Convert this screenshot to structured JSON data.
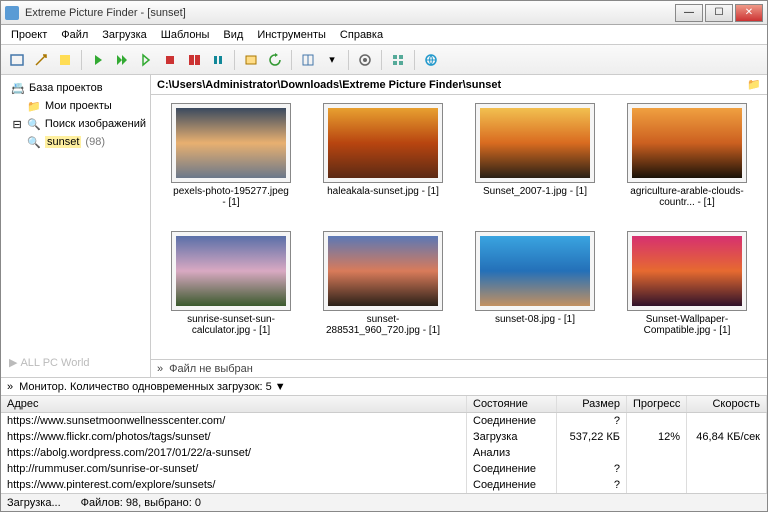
{
  "window": {
    "title": "Extreme Picture Finder - [sunset]"
  },
  "menu": [
    "Проект",
    "Файл",
    "Загрузка",
    "Шаблоны",
    "Вид",
    "Инструменты",
    "Справка"
  ],
  "sidebar": {
    "projects": "База проектов",
    "my_projects": "Мои проекты",
    "search": "Поиск изображений",
    "query": "sunset",
    "query_count": "(98)"
  },
  "watermark": "ALL PC World",
  "path": "C:\\Users\\Administrator\\Downloads\\Extreme Picture Finder\\sunset",
  "thumbs": [
    {
      "name": "pexels-photo-195277.jpeg - [1]",
      "g": "linear-gradient(#3a4a5f,#e8b070,#6b788a)"
    },
    {
      "name": "haleakala-sunset.jpg - [1]",
      "g": "linear-gradient(#e8a030,#b84510,#5b2a14)"
    },
    {
      "name": "Sunset_2007-1.jpg - [1]",
      "g": "linear-gradient(#f2c050,#d96b20,#2a2015)"
    },
    {
      "name": "agriculture-arable-clouds-countr... - [1]",
      "g": "linear-gradient(#f0a040,#cc6020,#1a1208)"
    },
    {
      "name": "sunrise-sunset-sun-calculator.jpg - [1]",
      "g": "linear-gradient(#5a6fa8,#d9a9c2,#3b5a2d)"
    },
    {
      "name": "sunset-288531_960_720.jpg - [1]",
      "g": "linear-gradient(#5b78b5,#d97b5a,#2b2018)"
    },
    {
      "name": "sunset-08.jpg - [1]",
      "g": "linear-gradient(#3aa4e0,#2470b8,#c29060)"
    },
    {
      "name": "Sunset-Wallpaper-Compatible.jpg - [1]",
      "g": "linear-gradient(#d63070,#e66a30,#30122a)"
    }
  ],
  "filesel": "Файл не выбран",
  "monitor": "Монитор. Количество одновременных загрузок: 5   ▼",
  "dl": {
    "headers": {
      "addr": "Адрес",
      "state": "Состояние",
      "size": "Размер",
      "prog": "Прогресс",
      "speed": "Скорость"
    },
    "rows": [
      {
        "addr": "https://www.sunsetmoonwellnesscenter.com/",
        "state": "Соединение",
        "size": "?",
        "prog": "",
        "speed": ""
      },
      {
        "addr": "https://www.flickr.com/photos/tags/sunset/",
        "state": "Загрузка",
        "size": "537,22 КБ",
        "prog": "12%",
        "speed": "46,84 КБ/сек"
      },
      {
        "addr": "https://abolg.wordpress.com/2017/01/22/a-sunset/",
        "state": "Анализ",
        "size": "",
        "prog": "",
        "speed": ""
      },
      {
        "addr": "http://rummuser.com/sunrise-or-sunset/",
        "state": "Соединение",
        "size": "?",
        "prog": "",
        "speed": ""
      },
      {
        "addr": "https://www.pinterest.com/explore/sunsets/",
        "state": "Соединение",
        "size": "?",
        "prog": "",
        "speed": ""
      }
    ]
  },
  "status": {
    "loading": "Загрузка...",
    "files": "Файлов: 98, выбрано: 0"
  }
}
